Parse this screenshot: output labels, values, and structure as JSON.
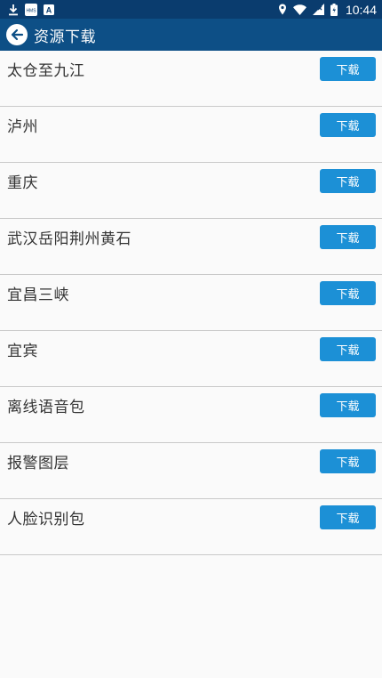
{
  "status_bar": {
    "time": "10:44",
    "left_icons": [
      "download-icon",
      "hms-notification-icon",
      "a-notification-icon"
    ],
    "right_icons": [
      "location-icon",
      "wifi-icon",
      "signal-icon",
      "battery-icon"
    ],
    "hms_label": "HMS",
    "a_label": "A"
  },
  "app_bar": {
    "title": "资源下载",
    "background": "#0d4f86"
  },
  "items": [
    {
      "label": "太仓至九江",
      "button": "下载"
    },
    {
      "label": "泸州",
      "button": "下载"
    },
    {
      "label": "重庆",
      "button": "下载"
    },
    {
      "label": "武汉岳阳荆州黄石",
      "button": "下载"
    },
    {
      "label": "宜昌三峡",
      "button": "下载"
    },
    {
      "label": "宜宾",
      "button": "下载"
    },
    {
      "label": "离线语音包",
      "button": "下载"
    },
    {
      "label": "报警图层",
      "button": "下载"
    },
    {
      "label": "人脸识别包",
      "button": "下载"
    }
  ],
  "colors": {
    "button": "#1c90d6",
    "status_bar": "#0a3c6e"
  }
}
